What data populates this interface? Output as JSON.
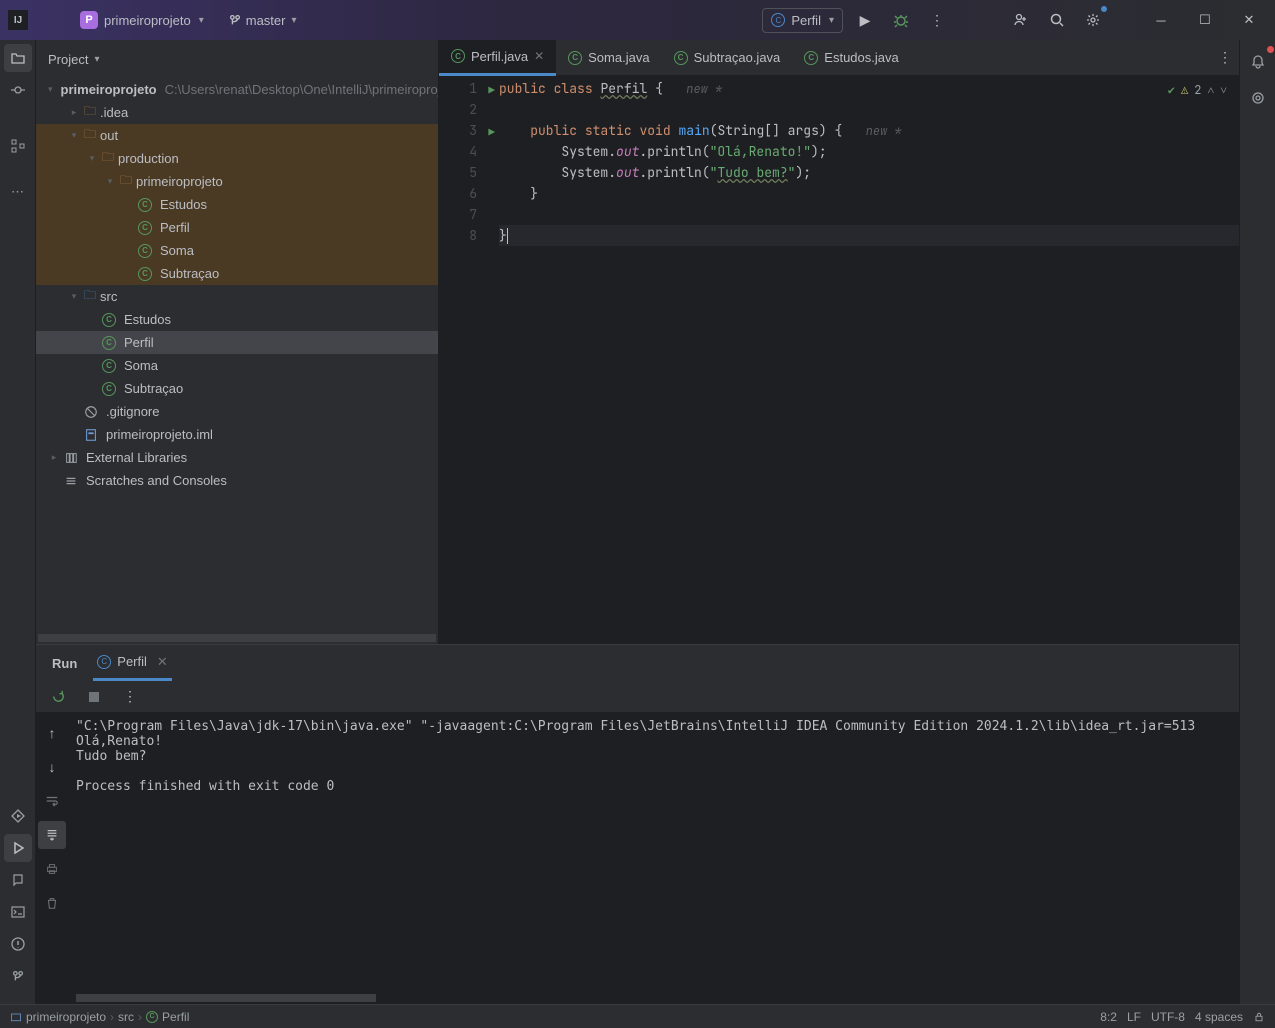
{
  "titlebar": {
    "project": "primeiroprojeto",
    "projectInitial": "P",
    "branch": "master",
    "runConfig": "Perfil"
  },
  "projectPanel": {
    "title": "Project",
    "rootName": "primeiroprojeto",
    "rootPath": "C:\\Users\\renat\\Desktop\\One\\IntelliJ\\primeiroprojeto",
    "idea": ".idea",
    "out": "out",
    "production": "production",
    "outProject": "primeiroprojeto",
    "outClasses": [
      "Estudos",
      "Perfil",
      "Soma",
      "Subtraçao"
    ],
    "src": "src",
    "srcClasses": [
      "Estudos",
      "Perfil",
      "Soma",
      "Subtraçao"
    ],
    "gitignore": ".gitignore",
    "iml": "primeiroprojeto.iml",
    "externalLibs": "External Libraries",
    "scratches": "Scratches and Consoles"
  },
  "editor": {
    "tabs": [
      {
        "label": "Perfil.java",
        "active": true
      },
      {
        "label": "Soma.java"
      },
      {
        "label": "Subtraçao.java"
      },
      {
        "label": "Estudos.java"
      }
    ],
    "inspections": "2",
    "hints": {
      "new": "new *",
      "new2": "new *"
    },
    "code": {
      "l1a": "public",
      "l1b": "class",
      "l1c": "Perfil",
      "l1d": " {",
      "l3a": "    public",
      "l3b": "static",
      "l3c": "void",
      "l3d": "main",
      "l3e": "(String[] args) {",
      "l4a": "        System.",
      "l4b": "out",
      "l4c": ".println(",
      "l4d": "\"Olá,Renato!\"",
      "l4e": ");",
      "l5a": "        System.",
      "l5b": "out",
      "l5c": ".println(",
      "l5d": "\"",
      "l5e": "Tudo bem?",
      "l5f": "\"",
      "l5g": ");",
      "l6": "    }",
      "l8": "}"
    }
  },
  "runPanel": {
    "title": "Run",
    "tab": "Perfil",
    "console": "\"C:\\Program Files\\Java\\jdk-17\\bin\\java.exe\" \"-javaagent:C:\\Program Files\\JetBrains\\IntelliJ IDEA Community Edition 2024.1.2\\lib\\idea_rt.jar=513\nOlá,Renato!\nTudo bem?\n\nProcess finished with exit code 0\n"
  },
  "breadcrumbs": {
    "p1": "primeiroprojeto",
    "p2": "src",
    "p3": "Perfil"
  },
  "status": {
    "pos": "8:2",
    "sep": "LF",
    "enc": "UTF-8",
    "indent": "4 spaces"
  }
}
